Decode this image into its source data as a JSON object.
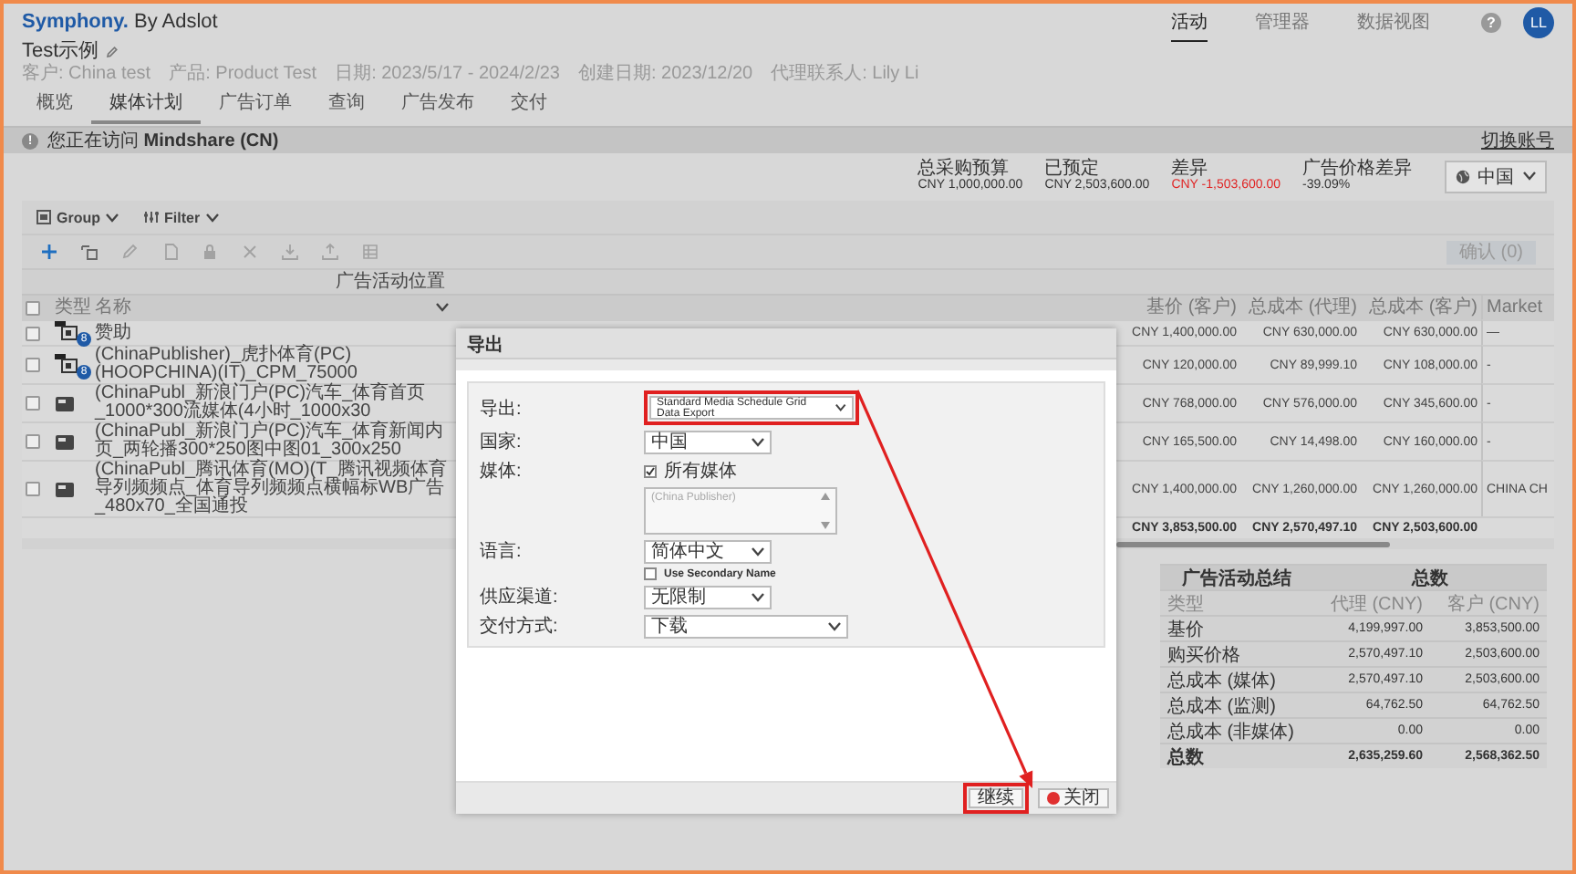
{
  "header": {
    "brand": "Symphony.",
    "tagline": "By Adslot",
    "nav": [
      {
        "label": "活动",
        "selected": true
      },
      {
        "label": "管理器",
        "selected": false
      },
      {
        "label": "数据视图",
        "selected": false
      }
    ],
    "help": "?",
    "avatar": "LL"
  },
  "plan": {
    "title": "Test示例",
    "meta": [
      "客户: China test",
      "产品: Product Test",
      "日期: 2023/5/17 - 2024/2/23",
      "创建日期: 2023/12/20",
      "代理联系人: Lily Li"
    ],
    "tabs": [
      {
        "label": "概览",
        "selected": false
      },
      {
        "label": "媒体计划",
        "selected": true
      },
      {
        "label": "广告订单",
        "selected": false
      },
      {
        "label": "查询",
        "selected": false
      },
      {
        "label": "广告发布",
        "selected": false
      },
      {
        "label": "交付",
        "selected": false
      }
    ]
  },
  "banner": {
    "icon": "!",
    "text": "您正在访问 **Mindshare (CN)**",
    "link": "切换账号"
  },
  "budget": {
    "stats": [
      {
        "label": "总采购预算",
        "value": "CNY 1,000,000.00",
        "alert": false
      },
      {
        "label": "已预定",
        "value": "CNY 2,503,600.00",
        "alert": false
      },
      {
        "label": "差异",
        "value": "CNY -1,503,600.00",
        "alert": true
      },
      {
        "label": "广告价格差异",
        "value": "-39.09%",
        "alert": false
      }
    ],
    "region": "中国"
  },
  "toolbar": {
    "group": "Group",
    "filter": "Filter",
    "actions": [
      {
        "disabled": false
      },
      {
        "disabled": false
      },
      {
        "disabled": true
      },
      {
        "disabled": true
      },
      {
        "disabled": true
      },
      {
        "disabled": true
      },
      {
        "disabled": true
      },
      {
        "disabled": true
      },
      {
        "disabled": true
      }
    ],
    "confirm": {
      "label": "确认 (0)",
      "disabled": true
    }
  },
  "table": {
    "group_header": "广告活动位置",
    "columns": [
      "类型",
      "名称",
      "基价 (客户)",
      "总成本 (代理)",
      "总成本 (客户)",
      "Market"
    ],
    "header_checked": false,
    "rows": [
      {
        "checked": false,
        "kind": "package",
        "badge": "8",
        "name": "赞助",
        "base": "CNY 1,400,000.00",
        "agency": "CNY 630,000.00",
        "client": "CNY 630,000.00",
        "market": "—"
      },
      {
        "checked": false,
        "kind": "package",
        "badge": "8",
        "name": "(ChinaPublisher)_虎扑体育(PC)(HOOPCHINA)(IT)_CPM_75000",
        "base": "CNY 120,000.00",
        "agency": "CNY 89,999.10",
        "client": "CNY 108,000.00",
        "market": "-"
      },
      {
        "checked": false,
        "kind": "image",
        "name": "(ChinaPubl_新浪门户(PC)汽车_体育首页_1000*300流媒体(4小时_1000x30",
        "base": "CNY 768,000.00",
        "agency": "CNY 576,000.00",
        "client": "CNY 345,600.00",
        "market": "-"
      },
      {
        "checked": false,
        "kind": "image",
        "name": "(ChinaPubl_新浪门户(PC)汽车_体育新闻内页_两轮播300*250图中图01_300x250",
        "base": "CNY 165,500.00",
        "agency": "CNY 14,498.00",
        "client": "CNY 160,000.00",
        "market": "-"
      },
      {
        "checked": false,
        "kind": "image",
        "name": "(ChinaPubl_腾讯体育(MO)(T_腾讯视频体育导列频频点_体育导列频频点横幅标WB广告_480x70_全国通投",
        "base": "CNY 1,400,000.00",
        "agency": "CNY 1,260,000.00",
        "client": "CNY 1,260,000.00",
        "market": "CHINA CH"
      }
    ],
    "totals": [
      "CNY 3,853,500.00",
      "CNY 2,570,497.10",
      "CNY 2,503,600.00"
    ]
  },
  "summary": {
    "title": "广告活动总结",
    "total_header": "总数",
    "columns": [
      "类型",
      "代理 (CNY)",
      "客户 (CNY)"
    ],
    "rows": [
      {
        "label": "基价",
        "agency": "4,199,997.00",
        "client": "3,853,500.00"
      },
      {
        "label": "购买价格",
        "agency": "2,570,497.10",
        "client": "2,503,600.00"
      },
      {
        "label": "总成本 (媒体)",
        "agency": "2,570,497.10",
        "client": "2,503,600.00"
      },
      {
        "label": "总成本 (监测)",
        "agency": "64,762.50",
        "client": "64,762.50"
      },
      {
        "label": "总成本 (非媒体)",
        "agency": "0.00",
        "client": "0.00"
      }
    ],
    "total": {
      "label": "总数",
      "agency": "2,635,259.60",
      "client": "2,568,362.50"
    }
  },
  "export_dialog": {
    "title": "导出",
    "fields": [
      {
        "kind": "select",
        "label": "导出:",
        "value": "Standard Media Schedule Grid Data Export",
        "highlighted": true
      },
      {
        "kind": "select",
        "label": "国家:",
        "value": "中国",
        "highlighted": false
      },
      {
        "kind": "checkbox",
        "label": "媒体:",
        "value": "所有媒体",
        "checked": true,
        "highlighted": false
      },
      {
        "kind": "listbox",
        "placeholder": "(China Publisher)",
        "highlighted": false
      },
      {
        "kind": "select",
        "label": "语言:",
        "value": "简体中文",
        "highlighted": false
      },
      {
        "kind": "checkbox",
        "value": "Use Secondary Name",
        "checked": false,
        "highlighted": false
      },
      {
        "kind": "select",
        "label": "供应渠道:",
        "value": "无限制",
        "highlighted": false
      },
      {
        "kind": "select",
        "label": "交付方式:",
        "value": "下载",
        "highlighted": false
      }
    ],
    "buttons": [
      {
        "kind": "primary",
        "label": "继续",
        "highlighted": true
      },
      {
        "kind": "close",
        "label": "关闭",
        "highlighted": false
      }
    ],
    "annotation_arrow": true
  }
}
